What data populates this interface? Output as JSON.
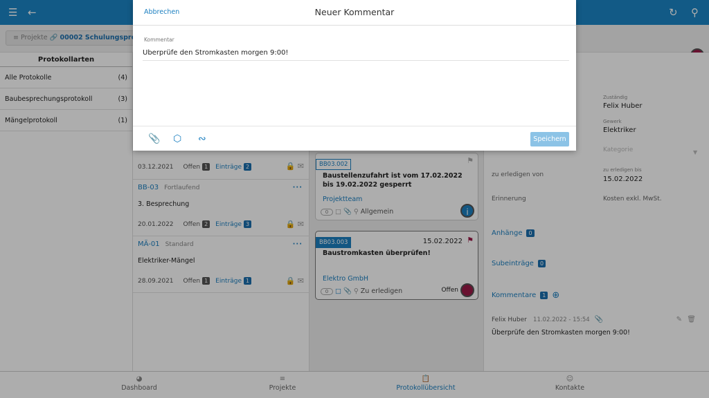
{
  "header": {
    "menu_icon": "menu-icon",
    "back_icon": "arrow-left-icon",
    "sync_icon": "sync-icon",
    "search_icon": "search-icon"
  },
  "breadcrumb": {
    "projects": "Projekte",
    "project": "00002 Schulungsproj"
  },
  "protocol_types": {
    "title": "Protokollarten",
    "items": [
      {
        "label": "Alle Protokolle",
        "count": "(4)"
      },
      {
        "label": "Baubesprechungsprotokoll",
        "count": "(3)"
      },
      {
        "label": "Mängelprotokoll",
        "count": "(1)"
      }
    ]
  },
  "protocols": [
    {
      "code": "",
      "kind": "",
      "title": "",
      "date": "03.12.2021",
      "open_label": "Offen",
      "open": "1",
      "entries_label": "Einträge",
      "entries": "2"
    },
    {
      "code": "BB-03",
      "kind": "Fortlaufend",
      "title": "3. Besprechung",
      "date": "20.01.2022",
      "open_label": "Offen",
      "open": "2",
      "entries_label": "Einträge",
      "entries": "3"
    },
    {
      "code": "MÄ-01",
      "kind": "Standard",
      "title": "Elektriker-Mängel",
      "date": "28.09.2021",
      "open_label": "Offen",
      "open": "1",
      "entries_label": "Einträge",
      "entries": "1"
    }
  ],
  "entries": [
    {
      "code": "BB03.002",
      "title": "Baustellenzufahrt ist vom 17.02.2022 bis 19.02.2022 gesperrt",
      "team": "Projektteam",
      "count": "0",
      "status": "Allgemein",
      "date": "",
      "state": ""
    },
    {
      "code": "BB03.003",
      "title": "Baustromkasten überprüfen!",
      "team": "Elektro GmbH",
      "count": "0",
      "status": "Zu erledigen",
      "date": "15.02.2022",
      "state": "Offen"
    }
  ],
  "details": {
    "responsible_label": "Zuständig",
    "responsible": "Felix Huber",
    "trade_label": "Gewerk",
    "trade": "Elektriker",
    "category_label": "Kategorie",
    "done_by_label": "zu erledigen von",
    "due_label": "zu erledigen bis",
    "due": "15.02.2022",
    "reminder_label": "Erinnerung",
    "costs_label": "Kosten exkl. MwSt.",
    "attachments_label": "Anhänge",
    "attachments": "0",
    "subentries_label": "Subeinträge",
    "subentries": "0",
    "comments_label": "Kommentare",
    "comments": "1",
    "comment": {
      "author": "Felix Huber",
      "time": "11.02.2022 - 15:54",
      "text": "Überprüfe den Stromkasten morgen 9:00!"
    }
  },
  "bottom_nav": [
    {
      "label": "Dashboard",
      "icon": "dashboard-icon"
    },
    {
      "label": "Projekte",
      "icon": "list-icon"
    },
    {
      "label": "Protokollübersicht",
      "icon": "clipboard-icon"
    },
    {
      "label": "Kontakte",
      "icon": "person-icon"
    }
  ],
  "modal": {
    "cancel": "Abbrechen",
    "title": "Neuer Kommentar",
    "field_label": "Kommentar",
    "field_value": "Überprüfe den Stromkasten morgen 9:00!",
    "save": "Speichern"
  },
  "colors": {
    "primary": "#1b85c6",
    "link": "#1b7fc0",
    "status_dot": "#9b1a48",
    "save_disabled": "#8cc3e6"
  }
}
